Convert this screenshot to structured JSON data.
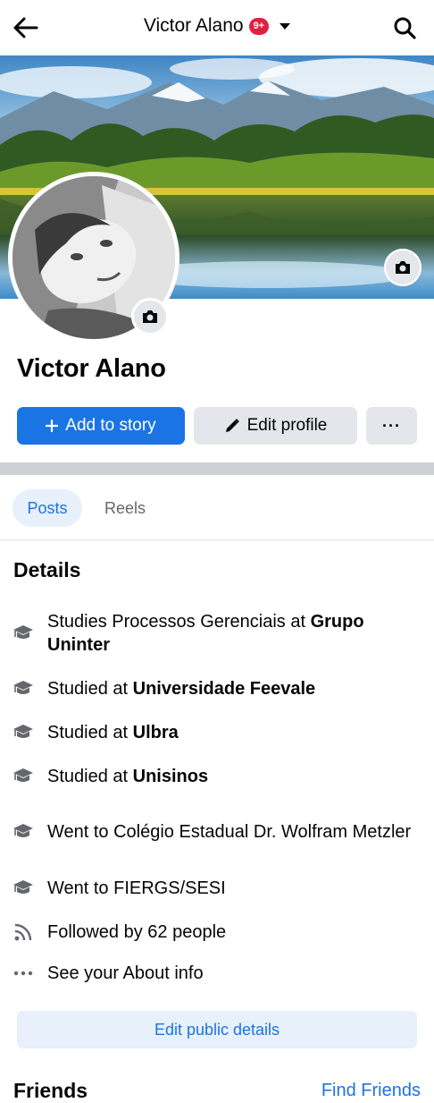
{
  "topbar": {
    "title": "Victor Alano",
    "badge": "9+",
    "back_icon": "arrow-left-icon",
    "search_icon": "search-icon"
  },
  "profile": {
    "name": "Victor Alano"
  },
  "actions": {
    "add_story": "Add to story",
    "edit_profile": "Edit profile",
    "more": "···"
  },
  "tabs": [
    {
      "label": "Posts",
      "active": true
    },
    {
      "label": "Reels",
      "active": false
    }
  ],
  "details": {
    "title": "Details",
    "items": [
      {
        "icon": "graduation-cap-icon",
        "prefix": "Studies Processos Gerenciais at ",
        "bold": "Grupo Uninter"
      },
      {
        "icon": "graduation-cap-icon",
        "prefix": "Studied at ",
        "bold": "Universidade Feevale"
      },
      {
        "icon": "graduation-cap-icon",
        "prefix": "Studied at ",
        "bold": "Ulbra"
      },
      {
        "icon": "graduation-cap-icon",
        "prefix": "Studied at ",
        "bold": "Unisinos"
      },
      {
        "icon": "graduation-cap-icon",
        "prefix": "Went to Colégio Estadual Dr. Wolfram Metzler",
        "bold": ""
      },
      {
        "icon": "graduation-cap-icon",
        "prefix": "Went to FIERGS/SESI",
        "bold": ""
      },
      {
        "icon": "rss-icon",
        "prefix": "Followed by 62 people",
        "bold": ""
      },
      {
        "icon": "more-dots-icon",
        "prefix": "See your About info",
        "bold": ""
      }
    ],
    "edit_button": "Edit public details"
  },
  "friends": {
    "title": "Friends",
    "link": "Find Friends"
  },
  "colors": {
    "accent": "#1b74e4",
    "button_grey": "#e4e6eb",
    "badge_red": "#e41e3f"
  }
}
